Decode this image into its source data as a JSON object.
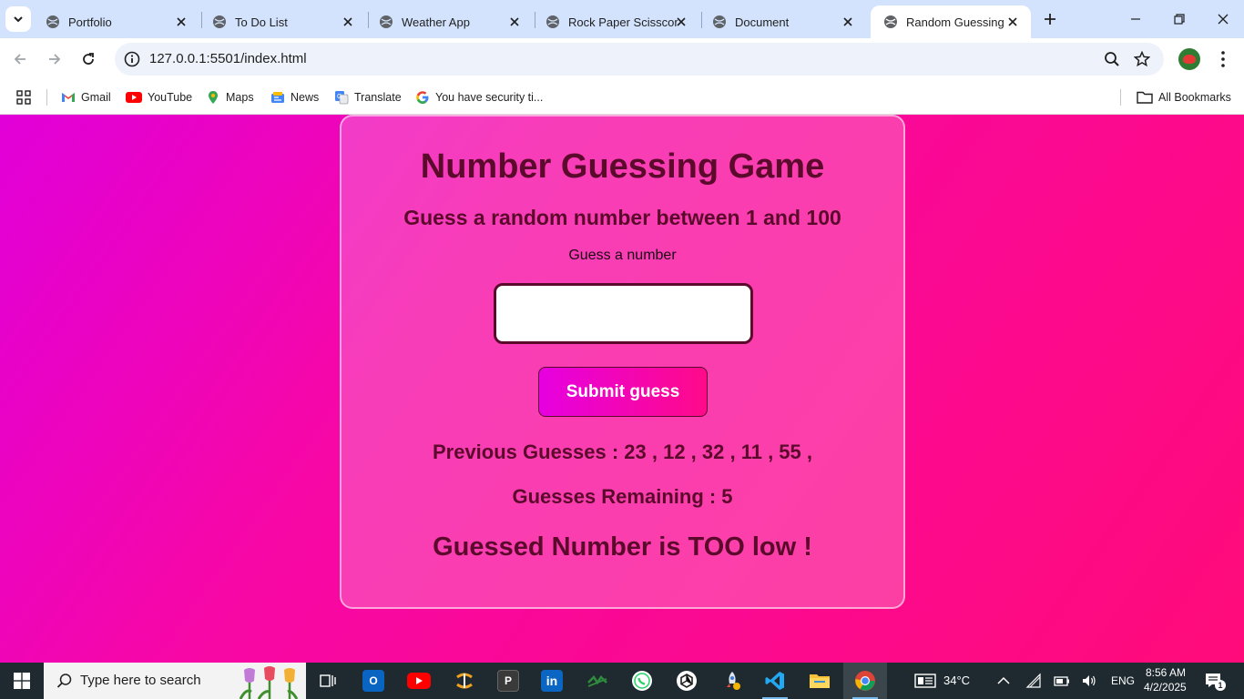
{
  "browser": {
    "tabs": [
      {
        "title": "Portfolio"
      },
      {
        "title": "To Do List"
      },
      {
        "title": "Weather App"
      },
      {
        "title": "Rock Paper Scisscor"
      },
      {
        "title": "Document"
      },
      {
        "title": "Random Guessing N"
      }
    ],
    "url": "127.0.0.1:5501/index.html",
    "bookmarks": [
      {
        "label": "Gmail"
      },
      {
        "label": "YouTube"
      },
      {
        "label": "Maps"
      },
      {
        "label": "News"
      },
      {
        "label": "Translate"
      },
      {
        "label": "You have security ti..."
      }
    ],
    "all_bookmarks": "All Bookmarks"
  },
  "game": {
    "title": "Number Guessing Game",
    "subtitle": "Guess a random number between 1 and 100",
    "input_label": "Guess a number",
    "input_value": "",
    "submit_label": "Submit guess",
    "previous_guesses": "Previous Guesses : 23 , 12 , 32 , 11 , 55 ,",
    "guesses_remaining": "Guesses Remaining : 5",
    "result": "Guessed Number is TOO low !"
  },
  "taskbar": {
    "search_placeholder": "Type here to search",
    "weather": "34°C",
    "language": "ENG",
    "time": "8:56 AM",
    "date": "4/2/2025",
    "notification_count": "1"
  }
}
